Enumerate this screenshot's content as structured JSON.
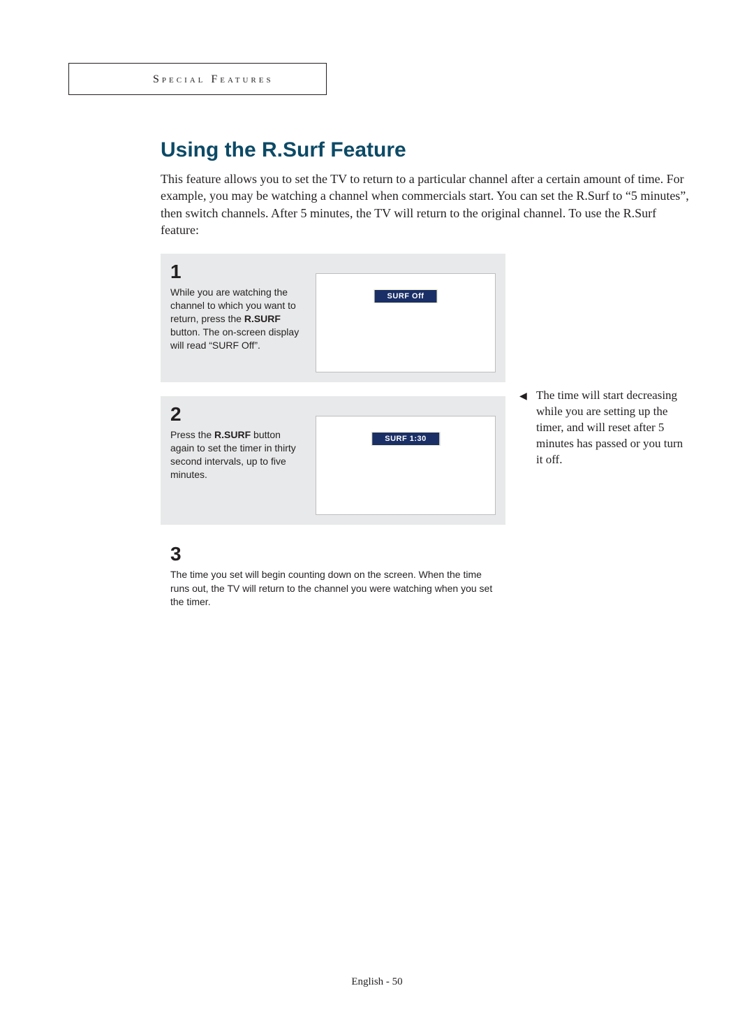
{
  "section_label": "Special Features",
  "heading": "Using the R.Surf Feature",
  "intro": "This feature allows you to set the TV to return to a particular channel after a certain amount of time. For example, you may be watching a channel when commercials start. You can set the R.Surf to “5 minutes”, then switch channels. After 5 minutes, the TV will return to the original channel. To use the R.Surf feature:",
  "steps": [
    {
      "num": "1",
      "pre": "While you are watching the channel to which you want to return, press the ",
      "bold": "R.SURF",
      "post": " button. The on-screen display will read “SURF Off”.",
      "osd": "SURF  Off"
    },
    {
      "num": "2",
      "pre": "Press the ",
      "bold": "R.SURF",
      "post": " button again to set the timer in thirty second intervals, up to five minutes.",
      "osd": "SURF  1:30"
    },
    {
      "num": "3",
      "text": "The time you set will begin counting down on the screen. When the time runs out, the TV will return to the channel you were watching when you set the timer."
    }
  ],
  "side_note": "The time will start decreasing while you are setting up the timer, and will reset after 5 minutes has passed or you turn it off.",
  "footer": "English - 50"
}
